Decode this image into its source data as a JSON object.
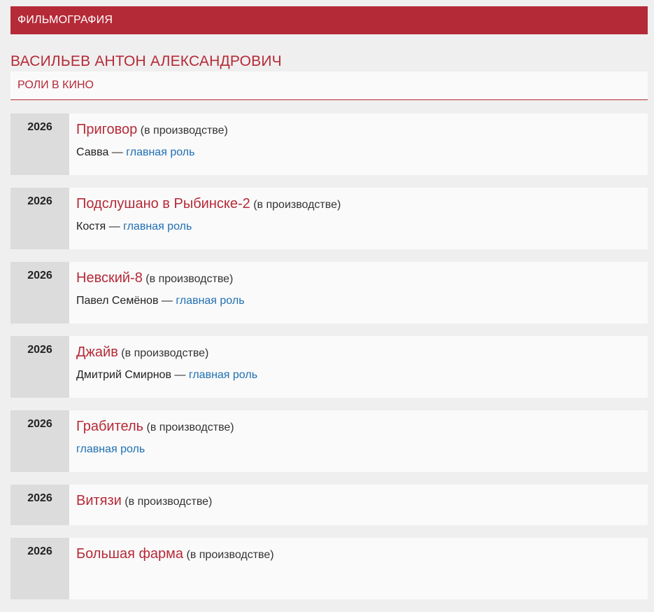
{
  "header": {
    "title": "ФИЛЬМОГРАФИЯ"
  },
  "person": {
    "name": "ВАСИЛЬЕВ АНТОН АЛЕКСАНДРОВИЧ"
  },
  "section": {
    "title": "РОЛИ В КИНО"
  },
  "colors": {
    "accent": "#b52a37",
    "link": "#1f6fb2"
  },
  "films": [
    {
      "year": "2026",
      "title": "Приговор",
      "status": "(в производстве)",
      "character": "Савва",
      "sep": " — ",
      "role_type": "главная роль"
    },
    {
      "year": "2026",
      "title": "Подслушано в Рыбинске-2",
      "status": "(в производстве)",
      "character": "Костя",
      "sep": " — ",
      "role_type": "главная роль"
    },
    {
      "year": "2026",
      "title": "Невский-8",
      "status": "(в производстве)",
      "character": "Павел Семёнов",
      "sep": " — ",
      "role_type": "главная роль"
    },
    {
      "year": "2026",
      "title": "Джайв",
      "status": "(в производстве)",
      "character": "Дмитрий Смирнов",
      "sep": " — ",
      "role_type": "главная роль"
    },
    {
      "year": "2026",
      "title": "Грабитель",
      "status": "(в производстве)",
      "character": "",
      "sep": "",
      "role_type": "главная роль"
    },
    {
      "year": "2026",
      "title": "Витязи",
      "status": "(в производстве)"
    },
    {
      "year": "2026",
      "title": "Большая фарма",
      "status": "(в производстве)"
    }
  ]
}
